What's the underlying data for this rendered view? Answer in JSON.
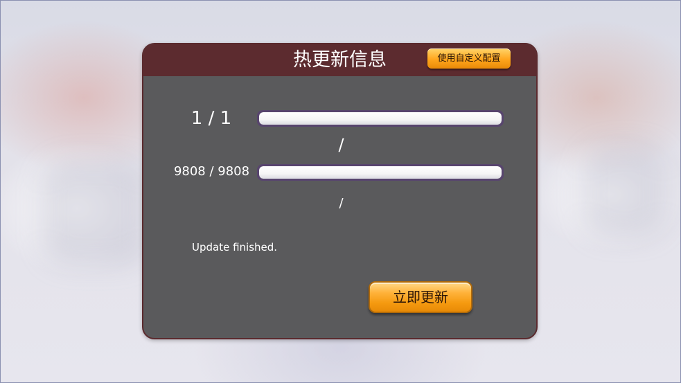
{
  "dialog": {
    "title": "热更新信息",
    "custom_config_button": "使用自定义配置",
    "file_progress": {
      "count_text": "1 / 1",
      "fraction": 1.0,
      "detail_text": "/"
    },
    "byte_progress": {
      "count_text": "9808 / 9808",
      "fraction": 1.0,
      "detail_text": "/"
    },
    "status_text": "Update finished.",
    "update_button": "立即更新"
  },
  "colors": {
    "panel_body": "#5a5a5c",
    "panel_header": "#5c2b2f",
    "button_orange": "#ffa51c",
    "bar_fill": "#ffffff"
  }
}
